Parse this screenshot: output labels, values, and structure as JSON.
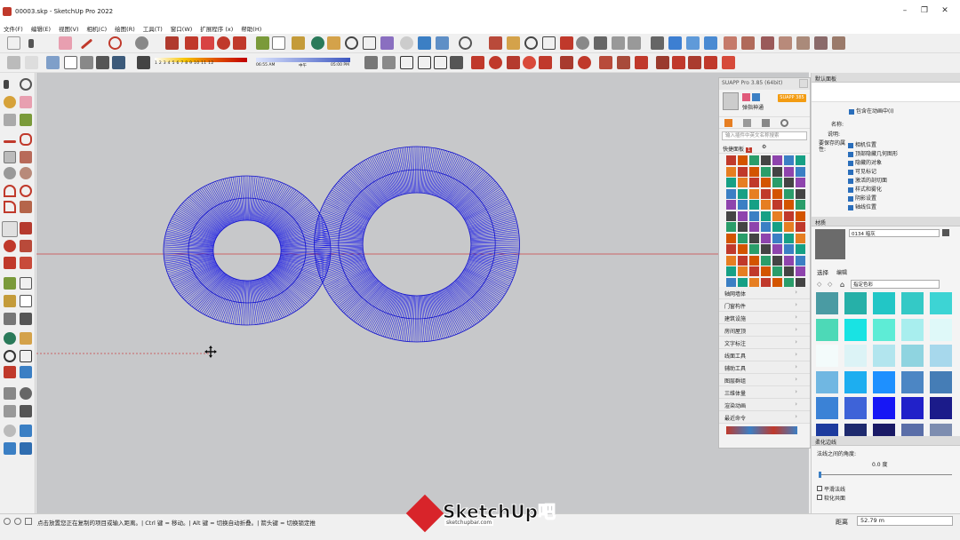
{
  "window": {
    "title": "00003.skp - SketchUp Pro 2022"
  },
  "menu": [
    "文件(F)",
    "编辑(E)",
    "视图(V)",
    "相机(C)",
    "绘图(R)",
    "工具(T)",
    "窗口(W)",
    "扩展程序 (x)",
    "帮助(H)"
  ],
  "shadow_bar": {
    "month_ticks": "1  2  3  4  5  6  7  8  9  10  11  12",
    "time_start": "06:55 AM",
    "time_mid": "中午",
    "time_end": "05:00 PM"
  },
  "suapp": {
    "title": "SUAPP Pro 3.85 (64bit)",
    "username": "弹指神通",
    "badge": "SUAPP 385",
    "search_placeholder": "输入插件中英文名称搜索",
    "quick_label": "快捷面板",
    "quick_badge": "1",
    "categories": [
      "轴网墙体",
      "门窗构件",
      "建筑设施",
      "房间屋顶",
      "文字标注",
      "线面工具",
      "辅助工具",
      "图层群组",
      "三维体量",
      "渲染动画",
      "最近命令"
    ]
  },
  "right_panel": {
    "header": "默认面板",
    "include_in_animation": "包含在动画中(I)",
    "name_label": "名称:",
    "desc_label": "说明:",
    "props_label": "要保存的属性:",
    "props": [
      "相机位置",
      "顶部隐藏几何图形",
      "隐藏的对象",
      "可见标记",
      "激活的剖切面",
      "样式和雾化",
      "阴影设置",
      "轴线位置"
    ],
    "material_header": "材质",
    "material_name": "0134 暗灰",
    "select_tab": "选择",
    "edit_tab": "编辑",
    "palette_select": "指定色彩",
    "palette_colors": [
      "#4a9ba3",
      "#26b0a8",
      "#22c6c6",
      "#34c9c6",
      "#3dd4d4",
      "#4dd9b7",
      "#19e3e3",
      "#5eecd6",
      "#a8eeee",
      "#dff9f9",
      "#f3fbfb",
      "#dcf3f6",
      "#b2e5ee",
      "#8fd4e0",
      "#a7d8ec",
      "#70b7e2",
      "#1daef0",
      "#1e90ff",
      "#4c86c4",
      "#457db6",
      "#3b82d6",
      "#3e63d8",
      "#1717f5",
      "#2121c9",
      "#1b1b8a",
      "#1d3b9e",
      "#1e2a6e",
      "#1a1a66",
      "#5a6ea8",
      "#7d8db0"
    ],
    "soften_header": "柔化边线",
    "normals_angle_label": "法线之间的角度:",
    "angle_value": "0.0",
    "angle_unit": "度",
    "smooth_normals": "平滑法线",
    "soften_coplanar": "软化共面"
  },
  "status": {
    "hint": "点击放置您正在复制的项目或输入距离。| Ctrl 键 = 移动。| Alt 键 = 切换自动折叠。| 箭头键 = 切换锁定推",
    "distance_label": "距离",
    "distance_value": "52.79 m"
  },
  "watermark": {
    "brand": "SketchUp吧",
    "url": "sketchupbar.com"
  }
}
